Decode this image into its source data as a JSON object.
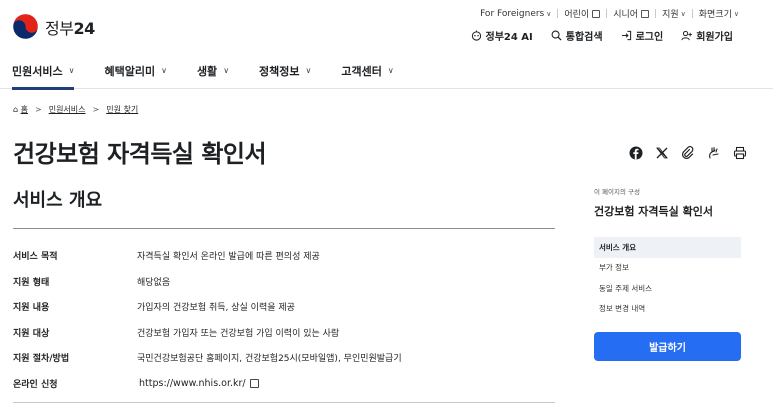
{
  "logo": {
    "text_prefix": "정부",
    "text_num": "24"
  },
  "util_links": [
    {
      "label": "For Foreigners",
      "icon": "chevron-down-icon"
    },
    {
      "label": "어린이",
      "icon": "external-link-icon"
    },
    {
      "label": "시니어",
      "icon": "external-link-icon"
    },
    {
      "label": "지원",
      "icon": "chevron-down-icon"
    },
    {
      "label": "화면크기",
      "icon": "chevron-down-icon"
    }
  ],
  "quick_links": [
    {
      "label": "정부24 AI",
      "icon": "ai-bot-icon"
    },
    {
      "label": "통합검색",
      "icon": "search-icon"
    },
    {
      "label": "로그인",
      "icon": "login-icon"
    },
    {
      "label": "회원가입",
      "icon": "user-plus-icon"
    }
  ],
  "nav": [
    {
      "label": "민원서비스",
      "active": true
    },
    {
      "label": "혜택알리미"
    },
    {
      "label": "생활"
    },
    {
      "label": "정책정보"
    },
    {
      "label": "고객센터"
    }
  ],
  "breadcrumb": {
    "home": "홈",
    "level1": "민원서비스",
    "level2": "민원 찾기"
  },
  "page_title": "건강보험 자격득실 확인서",
  "section_title": "서비스 개요",
  "rows": [
    {
      "key": "서비스 목적",
      "value": "자격득실 확인서 온라인 발급에 따른 편의성 제공"
    },
    {
      "key": "지원 형태",
      "value": "해당없음"
    },
    {
      "key": "지원 내용",
      "value": "가입자의 건강보험 취득, 상실 이력을 제공"
    },
    {
      "key": "지원 대상",
      "value": "건강보험 가입자 또는 건강보험 가입 이력이 있는 사람"
    },
    {
      "key": "지원 절차/방법",
      "value": "국민건강보험공단 홈페이지, 건강보험25시(모바일앱), 무인민원발급기"
    },
    {
      "key": "온라인 신청",
      "value": "https://www.nhis.or.kr/"
    }
  ],
  "toc": {
    "caption": "이 페이지의 구성",
    "title": "건강보험 자격득실 확인서",
    "items": [
      "서비스 개요",
      "부가 정보",
      "동일 주제 서비스",
      "정보 변경 내역"
    ]
  },
  "apply_button": "발급하기",
  "colors": {
    "primary": "#256ef4",
    "nav_underline": "#1e3f78",
    "toc_active_bg": "#eef2f7"
  }
}
